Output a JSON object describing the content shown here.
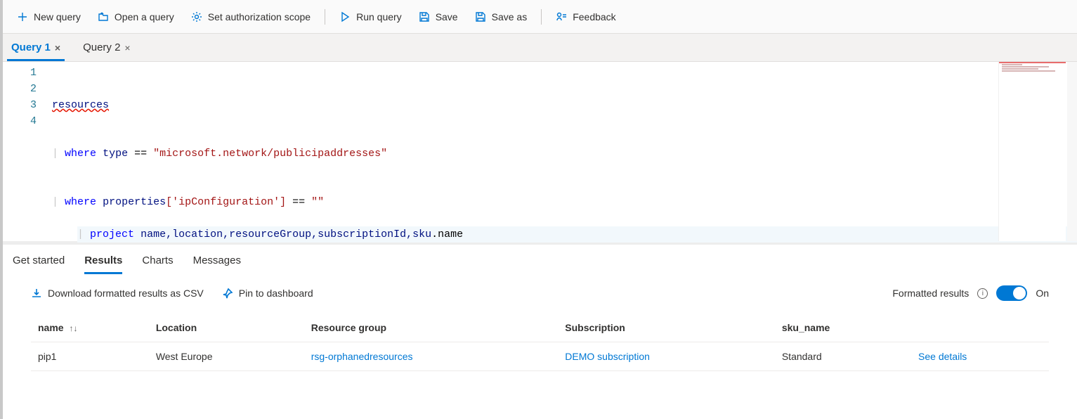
{
  "toolbar": {
    "new_query": "New query",
    "open_query": "Open a query",
    "set_scope": "Set authorization scope",
    "run_query": "Run query",
    "save": "Save",
    "save_as": "Save as",
    "feedback": "Feedback"
  },
  "query_tabs": [
    {
      "label": "Query 1",
      "active": true
    },
    {
      "label": "Query 2",
      "active": false
    }
  ],
  "editor": {
    "lines": [
      "1",
      "2",
      "3",
      "4"
    ],
    "code": {
      "l1": {
        "text": "resources"
      },
      "l2": {
        "pipe": "|",
        "kw": "where",
        "id": "type",
        "op": "==",
        "str": "\"microsoft.network/publicipaddresses\""
      },
      "l3": {
        "pipe": "|",
        "kw": "where",
        "id1": "properties",
        "idx": "['ipConfiguration']",
        "op": "==",
        "str": "\"\""
      },
      "l4": {
        "pipe": "|",
        "kw": "project",
        "ids": "name,location,resourceGroup,subscriptionId,sku",
        "tail": ".name"
      }
    }
  },
  "bottom_tabs": {
    "get_started": "Get started",
    "results": "Results",
    "charts": "Charts",
    "messages": "Messages"
  },
  "results_bar": {
    "download_csv": "Download formatted results as CSV",
    "pin_dashboard": "Pin to dashboard",
    "formatted_results": "Formatted results",
    "toggle_label": "On"
  },
  "results_table": {
    "headers": {
      "name": "name",
      "location": "Location",
      "rg": "Resource group",
      "sub": "Subscription",
      "sku": "sku_name",
      "details": ""
    },
    "sort_indicator": "↑↓",
    "rows": [
      {
        "name": "pip1",
        "location": "West Europe",
        "rg": "rsg-orphanedresources",
        "sub": "DEMO subscription",
        "sku": "Standard",
        "details": "See details"
      }
    ]
  }
}
